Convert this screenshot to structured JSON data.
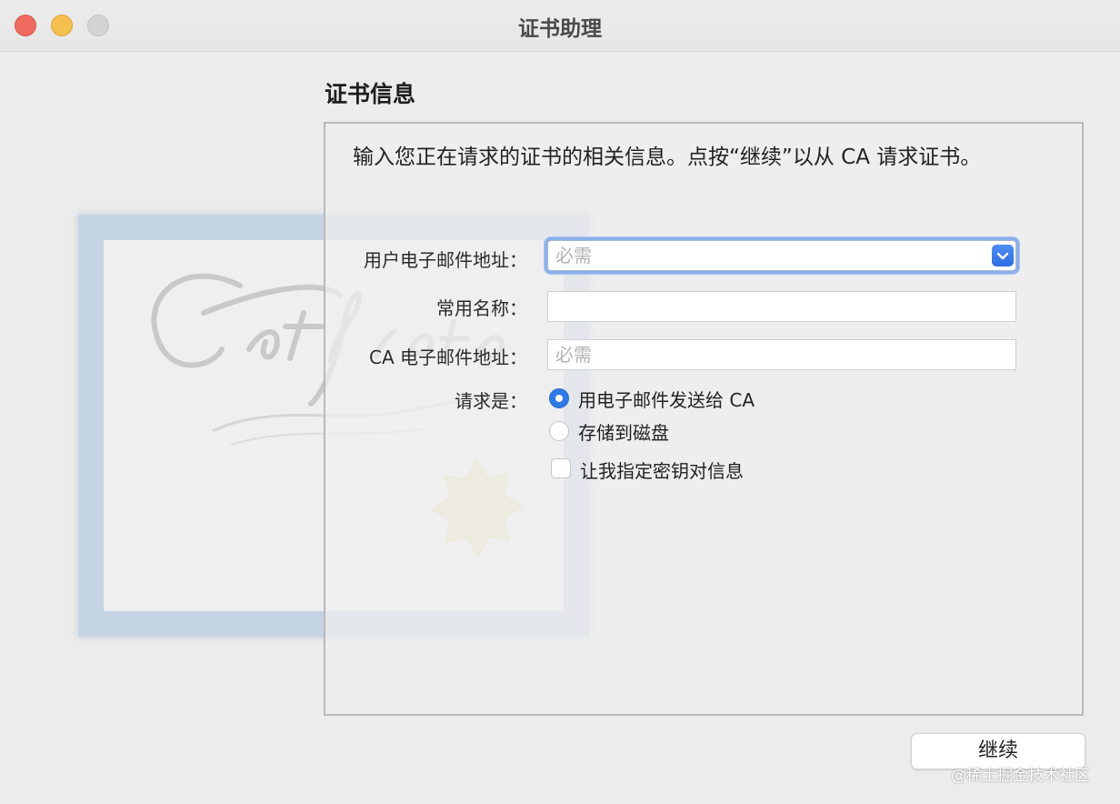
{
  "window": {
    "title": "证书助理"
  },
  "form": {
    "section_title": "证书信息",
    "intro": "输入您正在请求的证书的相关信息。点按“继续”以从 CA 请求证书。",
    "email_label": "用户电子邮件地址：",
    "email_placeholder": "必需",
    "email_value": "",
    "common_name_label": "常用名称：",
    "common_name_value": "",
    "ca_email_label": "CA 电子邮件地址：",
    "ca_email_placeholder": "必需",
    "ca_email_value": "",
    "request_label": "请求是：",
    "request_options": [
      {
        "label": "用电子邮件发送给 CA",
        "selected": true
      },
      {
        "label": "存储到磁盘",
        "selected": false
      }
    ],
    "key_pair_checkbox": {
      "label": "让我指定密钥对信息",
      "checked": false
    }
  },
  "footer": {
    "continue_label": "继续"
  },
  "watermark": "@稀土掘金技术社区",
  "colors": {
    "accent": "#2f7ae6",
    "focus_ring": "#8ab0ec",
    "close": "#ee6a5e",
    "minimize": "#f5bf4f",
    "zoom_inactive": "#d3d3d3"
  }
}
